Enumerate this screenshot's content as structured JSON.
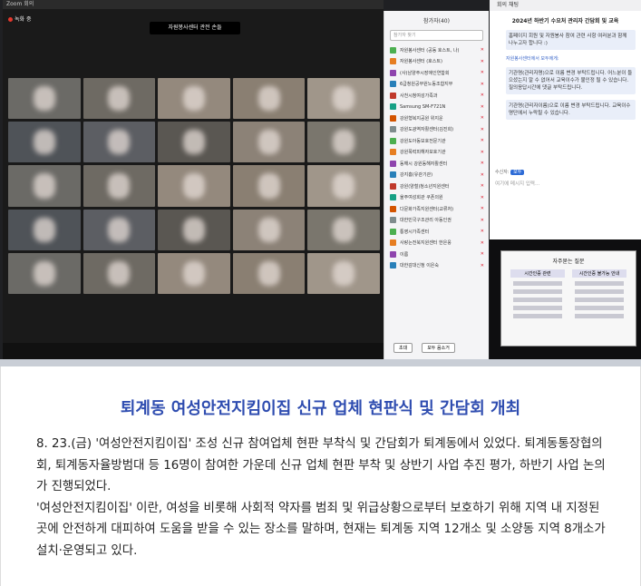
{
  "photo": {
    "zoom_title": "Zoom 회의",
    "rec_label": "녹화 중",
    "banner": "자원봉사센터 관전 손들",
    "participants_title": "참가자(40)",
    "search_placeholder": "참가자 찾기",
    "participants": [
      "자원봉사센터 (공동 호스트, 나)",
      "자원봉사센터 (호스트)",
      "(사)남양주시장애인연합회",
      "6급청원공무원노동조합지부",
      "사천시청여성가족과",
      "Samsung SM-F721N",
      "강원형복지공원 위지운",
      "강원도광역자활센터(김진희)",
      "강원도아동보호전문기관",
      "강원폭력피해자보호기관",
      "동해시 강원동해자활센터",
      "강지흠(유관기관)",
      "강원(양철)청소년지원센터",
      "울주여성회관 쿠폰의원",
      "다문화가족지원센터(교류처)",
      "대한민국구조관리 아동인권",
      "통영시가족센터",
      "사랑는전북지원센터 한은웅",
      "이름",
      "대한감대신청 이은숙"
    ],
    "btn_invite": "초대",
    "btn_mute": "모두 음소거",
    "chat_title": "회의 채팅",
    "chat_head": "2024년 하반기 수요처 관리자 간담회 및 교육",
    "chat_messages": [
      "홈페이지 회원 및 자원봉사 참여 관련 사항 여러분과 함께 나누고자 합니다 :)",
      "기관명(관리자명)으로 이름 변경 부탁드립니다.",
      "어느분이 들으셨는지 알 수 없어서 교육이수가 불인정 될 수 있습니다.",
      "질의응답시간에 댓글 부탁드립니다.",
      "기관명(관리자이름)으로 이름 변경 부탁드립니다.",
      "교육이수명단에서 누락될 수 있습니다."
    ],
    "chat_sender": "자원봉사센터에서 모두에게:",
    "chat_to_label": "수신자:",
    "chat_to_value": "모두",
    "chat_input_placeholder": "여기에 메시지 입력...",
    "slide_title": "자주묻는 질문",
    "slide_col1": "시간인증 관련",
    "slide_col2": "시간인증 불가능 안내"
  },
  "article": {
    "title": "퇴계동 여성안전지킴이집 신규 업체 현판식 및 간담회 개최",
    "paragraph1": "8. 23.(금) '여성안전지킴이집' 조성 신규 참여업체 현판 부착식 및 간담회가 퇴계동에서 있었다. 퇴계동통장협의회, 퇴계동자율방범대 등 16명이 참여한 가운데 신규 업체 현판 부착 및 상반기 사업 추진 평가, 하반기 사업 논의가 진행되었다.",
    "paragraph2": "'여성안전지킴이집' 이란, 여성을 비롯해 사회적 약자를 범죄 및 위급상황으로부터 보호하기 위해 지역 내 지정된 곳에 안전하게 대피하여 도움을 받을 수 있는 장소를 말하며, 현재는 퇴계동 지역 12개소 및 소양동 지역 8개소가 설치·운영되고 있다."
  },
  "colors": {
    "title_blue": "#2f4db0",
    "body_text": "#222222"
  }
}
